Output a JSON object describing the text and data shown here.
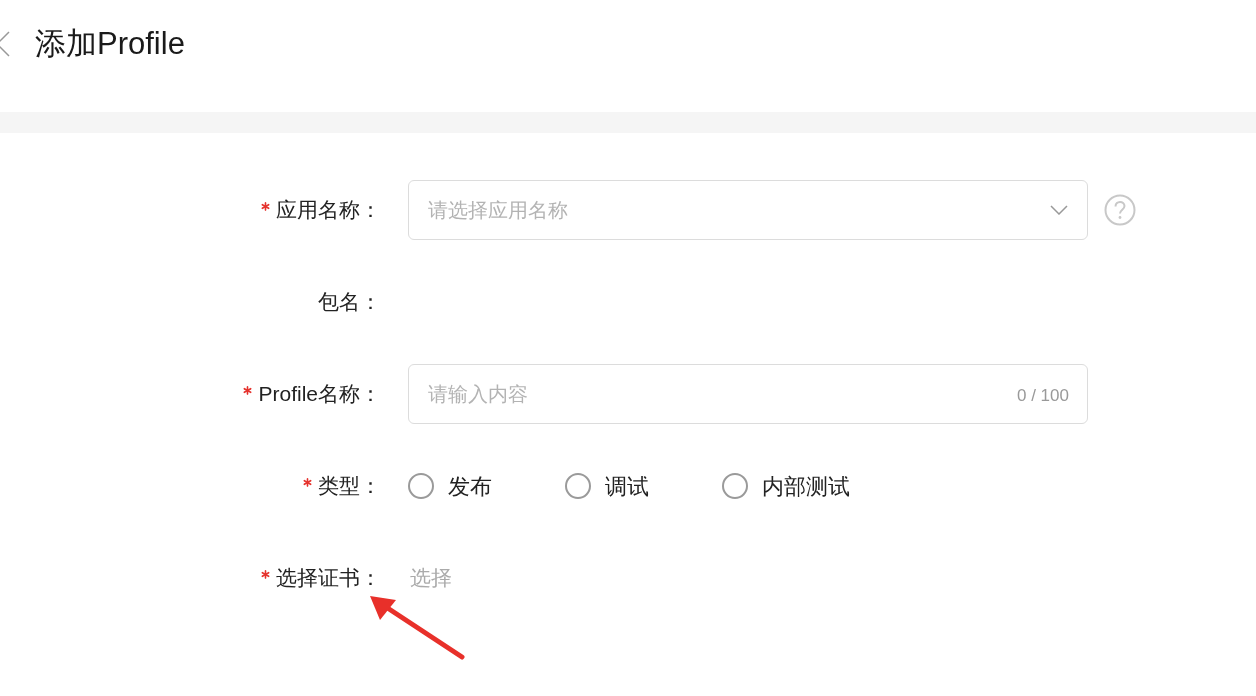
{
  "header": {
    "title": "添加Profile"
  },
  "form": {
    "fields": [
      {
        "kind": "select",
        "label": "应用名称：",
        "required": true,
        "placeholder": "请选择应用名称",
        "help": true
      },
      {
        "kind": "text",
        "label": "包名：",
        "required": false
      },
      {
        "kind": "input",
        "label": "Profile名称：",
        "required": true,
        "placeholder": "请输入内容",
        "counter": "0 / 100"
      },
      {
        "kind": "radio",
        "label": "类型：",
        "required": true,
        "options": [
          {
            "label": "发布",
            "selected": false
          },
          {
            "label": "调试",
            "selected": false
          },
          {
            "label": "内部测试",
            "selected": false
          }
        ]
      },
      {
        "kind": "link",
        "label": "选择证书：",
        "required": true,
        "link": "选择"
      }
    ]
  }
}
